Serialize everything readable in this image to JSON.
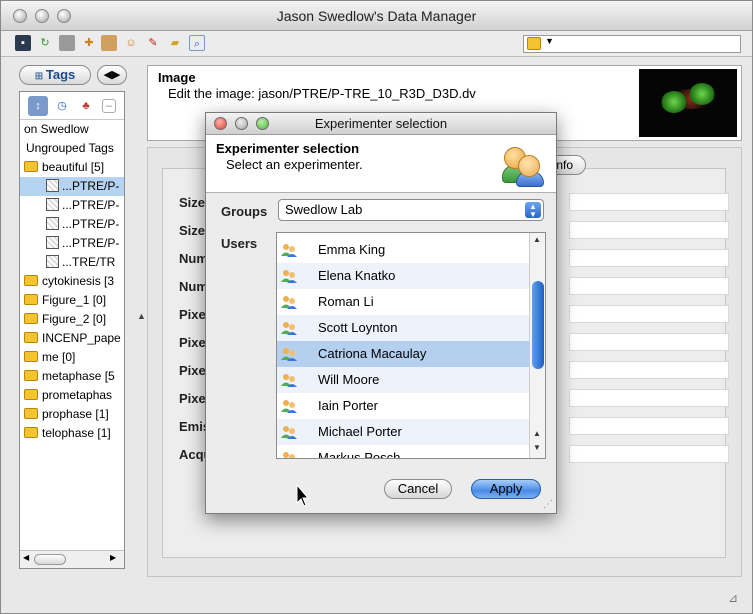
{
  "window": {
    "title": "Jason Swedlow's Data Manager"
  },
  "left_panel": {
    "tags_label": "Tags",
    "tree": {
      "items": [
        {
          "label": "on Swedlow"
        },
        {
          "label": "Ungrouped Tags"
        },
        {
          "label": "beautiful [5]"
        },
        {
          "label": "...PTRE/P-"
        },
        {
          "label": "...PTRE/P-"
        },
        {
          "label": "...PTRE/P-"
        },
        {
          "label": "...PTRE/P-"
        },
        {
          "label": "...TRE/TR"
        },
        {
          "label": "cytokinesis [3"
        },
        {
          "label": "Figure_1 [0]"
        },
        {
          "label": "Figure_2 [0]"
        },
        {
          "label": "INCENP_pape"
        },
        {
          "label": "me [0]"
        },
        {
          "label": "metaphase [5"
        },
        {
          "label": "prometaphas"
        },
        {
          "label": "prophase [1]"
        },
        {
          "label": "telophase [1]"
        }
      ]
    }
  },
  "image_header": {
    "title": "Image",
    "subtitle": "Edit the image: jason/PTRE/P-TRE_10_R3D_D3D.dv"
  },
  "info_panel": {
    "info_tab": "Info",
    "fields": [
      "Size",
      "Size",
      "Num",
      "Num",
      "Pixe",
      "Pixe",
      "Pixe",
      "Pixe",
      "Emis",
      "Acqu"
    ]
  },
  "dialog": {
    "title": "Experimenter selection",
    "heading": "Experimenter selection",
    "subheading": "Select an experimenter.",
    "groups_label": "Groups",
    "groups_selected": "Swedlow Lab",
    "users_label": "Users",
    "users": [
      {
        "name": "Emma King"
      },
      {
        "name": "Elena Knatko"
      },
      {
        "name": "Roman Li"
      },
      {
        "name": "Scott Loynton"
      },
      {
        "name": "Catriona Macaulay"
      },
      {
        "name": "Will Moore"
      },
      {
        "name": "Iain Porter"
      },
      {
        "name": "Michael Porter"
      },
      {
        "name": "Markus Posch"
      }
    ],
    "selected_user": "Catriona Macaulay",
    "cancel_label": "Cancel",
    "apply_label": "Apply"
  },
  "colors": {
    "selection": "#b5d0ee",
    "apply_button": "#4a8ae6",
    "close_button": "#e0443a",
    "minimize_button": "#f2b632",
    "zoom_button": "#4fb83a"
  }
}
